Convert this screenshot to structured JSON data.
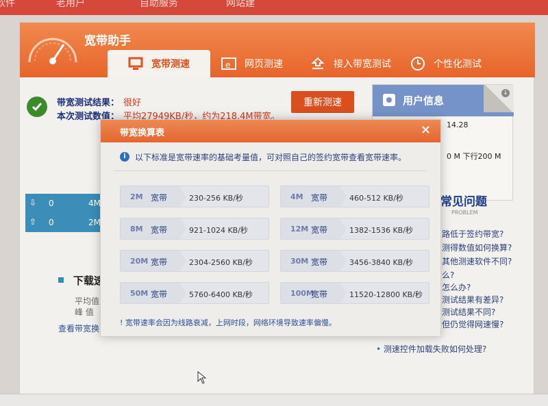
{
  "topnav": {
    "items": [
      "软件",
      "老用户",
      "自助服务",
      "网站建"
    ]
  },
  "app": {
    "title": "宽带助手"
  },
  "tabs": [
    {
      "label": "宽带测速",
      "icon": "monitor-icon"
    },
    {
      "label": "网页测速",
      "icon": "browser-icon"
    },
    {
      "label": "接入带宽测试",
      "icon": "upload-icon"
    },
    {
      "label": "个性化测试",
      "icon": "clock-icon"
    }
  ],
  "result": {
    "line1_label": "带宽测试结果：",
    "line1_value": "很好",
    "line2_label": "本次测试数值：",
    "line2_value": "平均27949KB/秒，约为218.4M带宽。"
  },
  "retest_label": "重新测速",
  "userinfo": {
    "title": "用户信息",
    "line1": "14.28",
    "line2": "0 M 下行200 M"
  },
  "speeds": {
    "down_value": "0",
    "down_max": "4M",
    "up_value": "0",
    "up_max": "2M"
  },
  "download": {
    "title": "下载速",
    "sub1": "平均值",
    "sub2": "峰 值",
    "link": "查看带宽换"
  },
  "faq": {
    "title": "常见问题",
    "subtitle": "PROBLEM",
    "items": [
      "路低于签约带宽?",
      "测得数值如何换算?",
      "其他测速软件不同?",
      "么?",
      "怎么办?",
      "测试结果有差异?",
      "测试结果不同?",
      "但仍觉得网速慢?",
      "测速控件加载失败如何处理?"
    ]
  },
  "modal": {
    "title": "带宽换算表",
    "note": "以下标准是宽带速率的基础考量值，可对照自己的签约宽带查看宽带速率。",
    "kd_label": "宽带",
    "rows": [
      {
        "size": "2M",
        "range": "230-256 KB/秒"
      },
      {
        "size": "4M",
        "range": "460-512 KB/秒"
      },
      {
        "size": "8M",
        "range": "921-1024 KB/秒"
      },
      {
        "size": "12M",
        "range": "1382-1536 KB/秒"
      },
      {
        "size": "20M",
        "range": "2304-2560 KB/秒"
      },
      {
        "size": "30M",
        "range": "3456-3840 KB/秒"
      },
      {
        "size": "50M",
        "range": "5760-6400 KB/秒"
      },
      {
        "size": "100M",
        "range": "11520-12800 KB/秒"
      }
    ],
    "footer": "! 宽带速率会因为线路衰减，上网时段，网络环境导致速率偏慢。"
  }
}
